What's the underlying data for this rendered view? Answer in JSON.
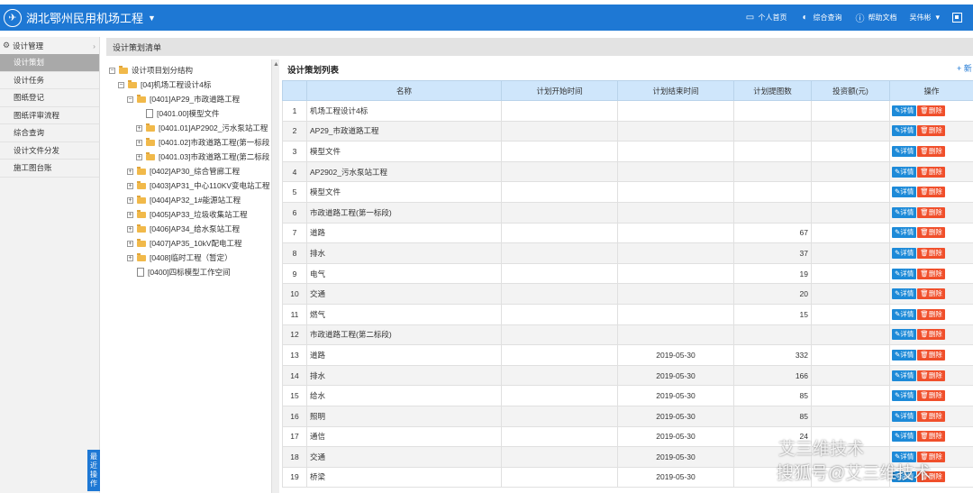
{
  "header": {
    "title": "湖北鄂州民用机场工程",
    "links": [
      "个人首页",
      "综合查询",
      "帮助文档"
    ],
    "user": "吴伟彬"
  },
  "sidebar": {
    "section": "设计管理",
    "items": [
      "设计策划",
      "设计任务",
      "图纸登记",
      "图纸评审流程",
      "综合查询",
      "设计文件分发",
      "施工图台账"
    ],
    "active_index": 0,
    "recent_tab": "最近操作"
  },
  "breadcrumb": "设计策划清单",
  "tree": {
    "nodes": [
      {
        "label": "设计项目划分结构",
        "type": "folder",
        "toggle": "⊟",
        "indent": 0
      },
      {
        "label": "[04]机场工程设计4标",
        "type": "folder",
        "toggle": "⊟",
        "indent": 1
      },
      {
        "label": "[0401]AP29_市政道路工程",
        "type": "folder",
        "toggle": "⊟",
        "indent": 2
      },
      {
        "label": "[0401.00]模型文件",
        "type": "doc",
        "toggle": "",
        "indent": 3
      },
      {
        "label": "[0401.01]AP2902_污水泵站工程",
        "type": "folder",
        "toggle": "⊞",
        "indent": 3
      },
      {
        "label": "[0401.02]市政道路工程(第一标段",
        "type": "folder",
        "toggle": "⊞",
        "indent": 3
      },
      {
        "label": "[0401.03]市政道路工程(第二标段",
        "type": "folder",
        "toggle": "⊞",
        "indent": 3
      },
      {
        "label": "[0402]AP30_综合管廊工程",
        "type": "folder",
        "toggle": "⊞",
        "indent": 2
      },
      {
        "label": "[0403]AP31_中心110KV变电站工程",
        "type": "folder",
        "toggle": "⊞",
        "indent": 2
      },
      {
        "label": "[0404]AP32_1#能源站工程",
        "type": "folder",
        "toggle": "⊞",
        "indent": 2
      },
      {
        "label": "[0405]AP33_垃圾收集站工程",
        "type": "folder",
        "toggle": "⊞",
        "indent": 2
      },
      {
        "label": "[0406]AP34_给水泵站工程",
        "type": "folder",
        "toggle": "⊞",
        "indent": 2
      },
      {
        "label": "[0407]AP35_10kV配电工程",
        "type": "folder",
        "toggle": "⊞",
        "indent": 2
      },
      {
        "label": "[0408]临时工程（暂定）",
        "type": "folder",
        "toggle": "⊞",
        "indent": 2
      },
      {
        "label": "[0400]四标模型工作空间",
        "type": "doc",
        "toggle": "",
        "indent": 2
      }
    ]
  },
  "list": {
    "title": "设计策划列表",
    "add_label": "+ 新",
    "columns": [
      "",
      "名称",
      "计划开始时间",
      "计划结束时间",
      "计划提图数",
      "投资额(元)",
      "操作"
    ],
    "detail_label": "详情",
    "delete_label": "删除",
    "rows": [
      {
        "no": "1",
        "name": "机场工程设计4标",
        "start": "",
        "end": "",
        "count": "",
        "amount": ""
      },
      {
        "no": "2",
        "name": "AP29_市政道路工程",
        "start": "",
        "end": "",
        "count": "",
        "amount": ""
      },
      {
        "no": "3",
        "name": "模型文件",
        "start": "",
        "end": "",
        "count": "",
        "amount": ""
      },
      {
        "no": "4",
        "name": "AP2902_污水泵站工程",
        "start": "",
        "end": "",
        "count": "",
        "amount": ""
      },
      {
        "no": "5",
        "name": "模型文件",
        "start": "",
        "end": "",
        "count": "",
        "amount": ""
      },
      {
        "no": "6",
        "name": "市政道路工程(第一标段)",
        "start": "",
        "end": "",
        "count": "",
        "amount": ""
      },
      {
        "no": "7",
        "name": "道路",
        "start": "",
        "end": "",
        "count": "67",
        "amount": ""
      },
      {
        "no": "8",
        "name": "排水",
        "start": "",
        "end": "",
        "count": "37",
        "amount": ""
      },
      {
        "no": "9",
        "name": "电气",
        "start": "",
        "end": "",
        "count": "19",
        "amount": ""
      },
      {
        "no": "10",
        "name": "交通",
        "start": "",
        "end": "",
        "count": "20",
        "amount": ""
      },
      {
        "no": "11",
        "name": "燃气",
        "start": "",
        "end": "",
        "count": "15",
        "amount": ""
      },
      {
        "no": "12",
        "name": "市政道路工程(第二标段)",
        "start": "",
        "end": "",
        "count": "",
        "amount": ""
      },
      {
        "no": "13",
        "name": "道路",
        "start": "",
        "end": "2019-05-30",
        "count": "332",
        "amount": ""
      },
      {
        "no": "14",
        "name": "排水",
        "start": "",
        "end": "2019-05-30",
        "count": "166",
        "amount": ""
      },
      {
        "no": "15",
        "name": "给水",
        "start": "",
        "end": "2019-05-30",
        "count": "85",
        "amount": ""
      },
      {
        "no": "16",
        "name": "照明",
        "start": "",
        "end": "2019-05-30",
        "count": "85",
        "amount": ""
      },
      {
        "no": "17",
        "name": "通信",
        "start": "",
        "end": "2019-05-30",
        "count": "24",
        "amount": ""
      },
      {
        "no": "18",
        "name": "交通",
        "start": "",
        "end": "2019-05-30",
        "count": "",
        "amount": ""
      },
      {
        "no": "19",
        "name": "桥梁",
        "start": "",
        "end": "2019-05-30",
        "count": "",
        "amount": ""
      }
    ]
  },
  "watermark": {
    "line1": "艾三维技术",
    "line2": "搜狐号@艾三维技术"
  },
  "colors": {
    "header_bg": "#1e78d4",
    "table_header_bg": "#cfe6fb",
    "detail_btn": "#1d8ad8",
    "delete_btn": "#f04f2b",
    "sidebar_active": "#a9a9a9"
  }
}
